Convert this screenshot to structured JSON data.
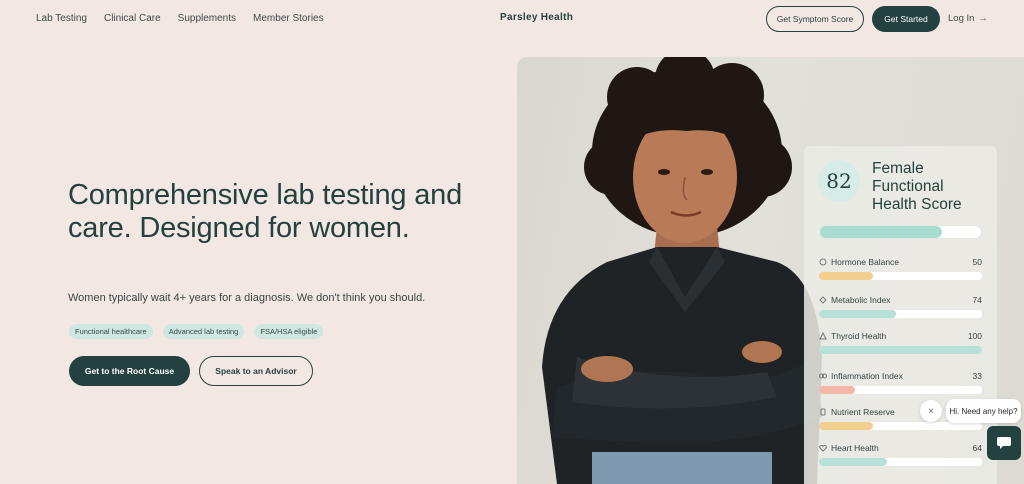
{
  "nav": {
    "links": [
      "Lab Testing",
      "Clinical Care",
      "Supplements",
      "Member Stories"
    ],
    "brand": "Parsley Health",
    "symptom_btn": "Get Symptom Score",
    "started_btn": "Get Started",
    "login": "Log In",
    "login_arrow": "→"
  },
  "hero": {
    "title": "Comprehensive lab testing and care. Designed for women.",
    "subtitle": "Women typically wait 4+ years for a diagnosis. We don't think you should.",
    "tags": [
      "Functional healthcare",
      "Advanced lab testing",
      "FSA/HSA eligible"
    ],
    "primary_btn": "Get to the Root Cause",
    "secondary_btn": "Speak to an Advisor"
  },
  "card": {
    "score": "82",
    "title": "Female Functional Health Score",
    "overall_fraction": 0.76,
    "metrics": [
      {
        "name": "Hormone Balance",
        "value": "50",
        "fraction": 0.33,
        "color": "#f2cf8f",
        "icon": "hormone-icon"
      },
      {
        "name": "Metabolic Index",
        "value": "74",
        "fraction": 0.47,
        "color": "#b7e0d6",
        "icon": "metabolic-icon"
      },
      {
        "name": "Thyroid Health",
        "value": "100",
        "fraction": 1.0,
        "color": "#b7e0d6",
        "icon": "thyroid-icon"
      },
      {
        "name": "Inflammation Index",
        "value": "33",
        "fraction": 0.22,
        "color": "#f2b7a8",
        "icon": "inflammation-icon"
      },
      {
        "name": "Nutrient Reserve",
        "value": "",
        "fraction": 0.33,
        "color": "#f2cf8f",
        "icon": "nutrient-icon"
      },
      {
        "name": "Heart Health",
        "value": "64",
        "fraction": 0.42,
        "color": "#b7e0d6",
        "icon": "heart-icon"
      }
    ]
  },
  "chat": {
    "bubble": "Hi. Need any help?",
    "close": "×"
  }
}
